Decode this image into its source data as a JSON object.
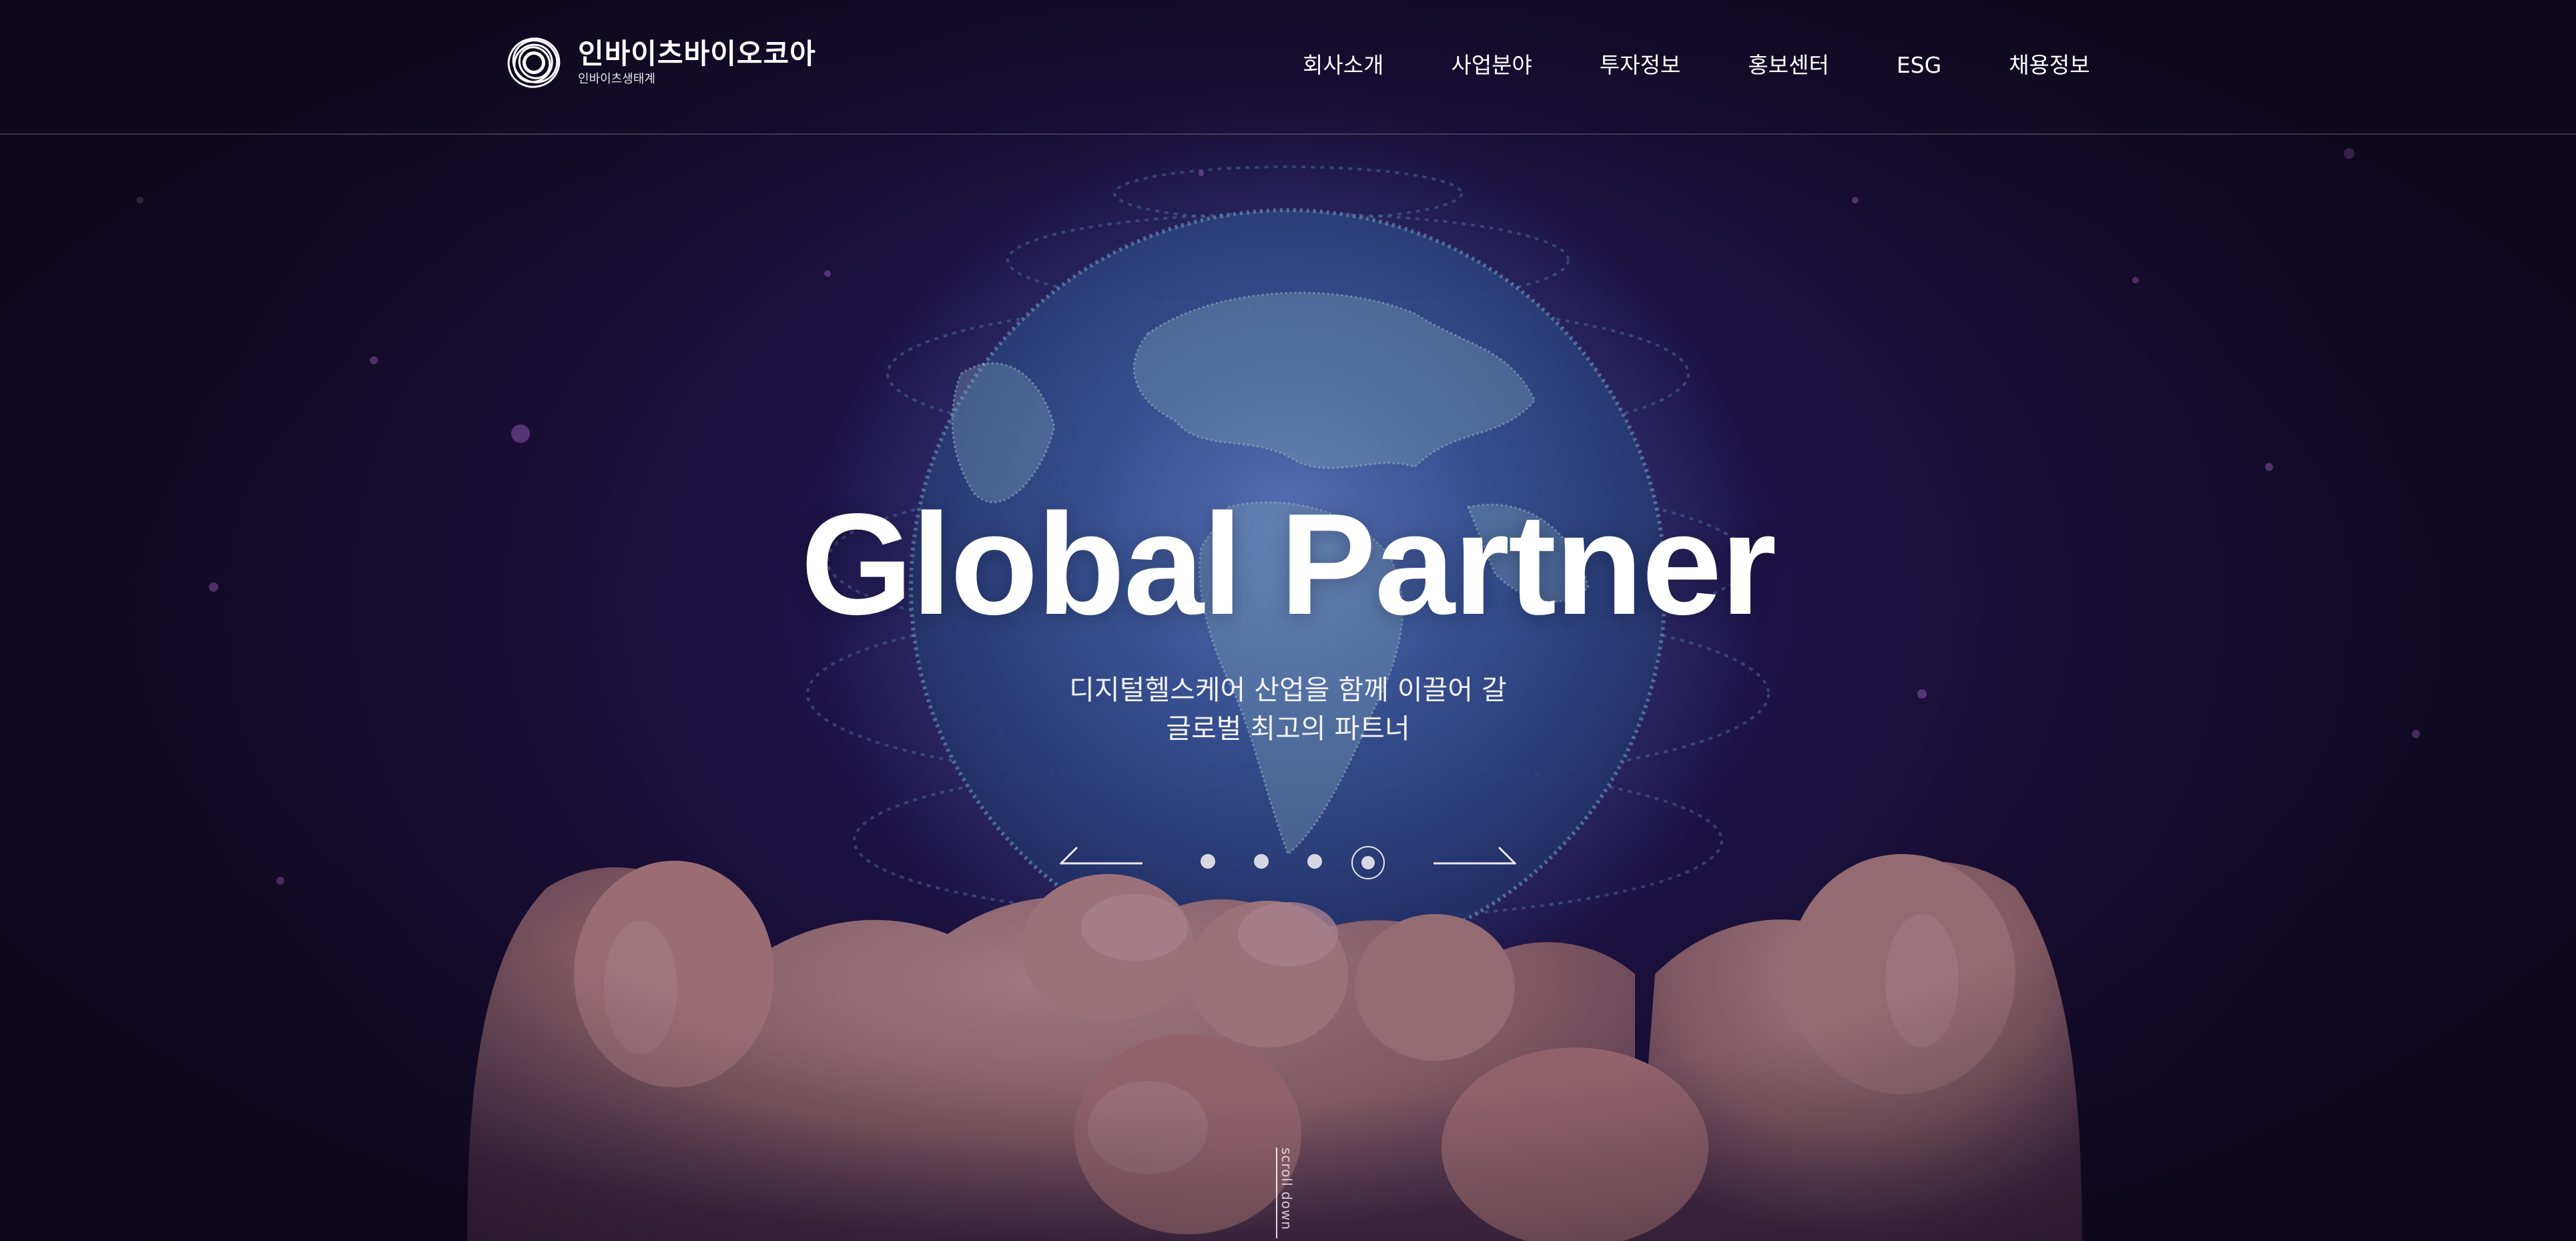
{
  "brand": {
    "name": "인바이츠바이오코아",
    "sub": "인바이츠생태계"
  },
  "nav": {
    "items": [
      {
        "label": "회사소개"
      },
      {
        "label": "사업분야"
      },
      {
        "label": "투자정보"
      },
      {
        "label": "홍보센터"
      },
      {
        "label": "ESG"
      },
      {
        "label": "채용정보"
      }
    ]
  },
  "hero": {
    "headline": "Global Partner",
    "sub_line_1": "디지털헬스케어 산업을 함께 이끌어 갈",
    "sub_line_2": "글로벌 최고의 파트너"
  },
  "slider": {
    "slide_count": 4,
    "active_index": 4
  },
  "scroll": {
    "label": "scroll down"
  },
  "colors": {
    "text": "#ffffff",
    "background": "#120b24",
    "globe_glow": "#4f7ad2",
    "hand": "#c99687"
  },
  "icons": [
    "logo-mark-icon",
    "prev-arrow-icon",
    "next-arrow-icon"
  ]
}
